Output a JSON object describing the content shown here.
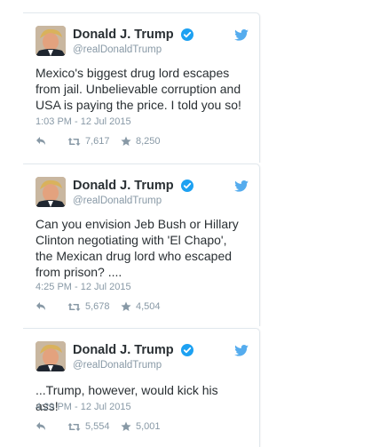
{
  "tweets": [
    {
      "display_name": "Donald J. Trump",
      "handle": "@realDonaldTrump",
      "text": "Mexico's biggest drug lord escapes from jail. Unbelievable corruption and USA is paying the price.  I told you so!",
      "timestamp": "1:03 PM - 12 Jul 2015",
      "retweets": "7,617",
      "likes": "8,250"
    },
    {
      "display_name": "Donald J. Trump",
      "handle": "@realDonaldTrump",
      "text": "Can you envision Jeb Bush or Hillary Clinton negotiating with 'El Chapo', the Mexican drug lord who escaped from prison? ....",
      "timestamp": "4:25 PM - 12 Jul 2015",
      "retweets": "5,678",
      "likes": "4,504"
    },
    {
      "display_name": "Donald J. Trump",
      "handle": "@realDonaldTrump",
      "text": "...Trump, however, would kick his ass!",
      "timestamp": "4:29 PM - 12 Jul 2015",
      "retweets": "5,554",
      "likes": "5,001"
    }
  ],
  "icons": {
    "verified": "verified-badge-icon",
    "bird": "twitter-bird-icon",
    "reply": "reply-icon",
    "retweet": "retweet-icon",
    "like": "star-icon"
  },
  "colors": {
    "twitter_blue": "#55acee",
    "verified_blue": "#1da1f2",
    "meta_gray": "#8899a6",
    "text": "#292f33"
  }
}
